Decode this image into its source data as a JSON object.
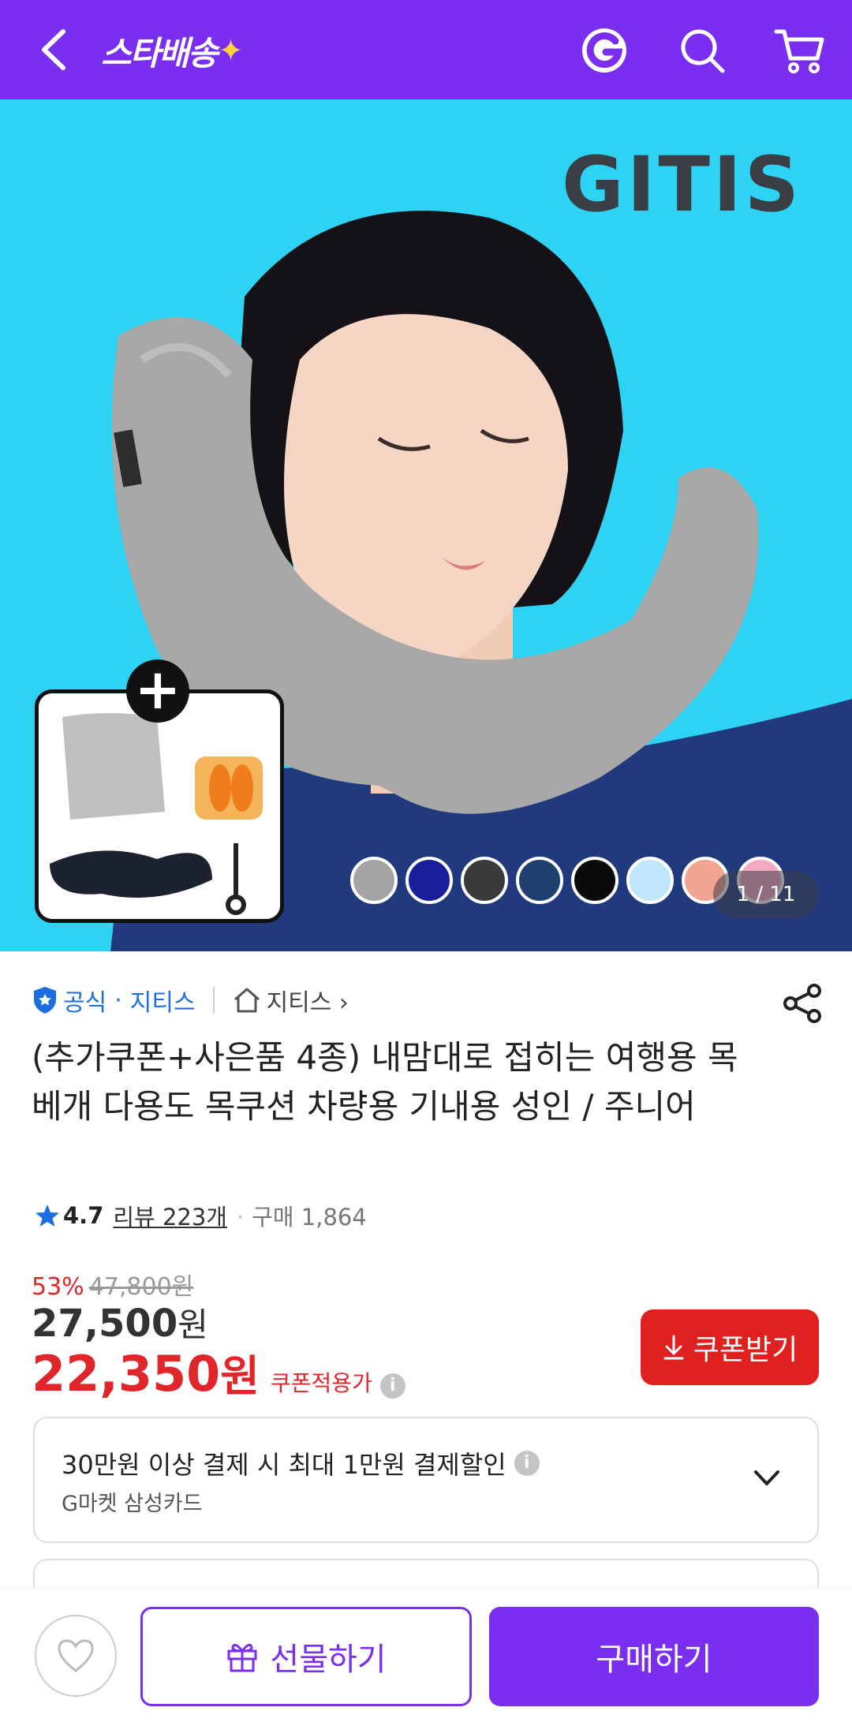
{
  "header": {
    "logo_text": "스타배송",
    "logo_sparkle": "✦",
    "icons": [
      "back-icon",
      "g-icon",
      "search-icon",
      "cart-icon"
    ]
  },
  "hero": {
    "brand": "GITIS",
    "page_indicator": "1 / 11",
    "swatch_colors": [
      "#a4a4a4",
      "#1b1e9a",
      "#3a3a3a",
      "#1f3f6e",
      "#0a0a0a",
      "#bfe6fb",
      "#f2a593",
      "#f3a9c2"
    ]
  },
  "store": {
    "official_label": "공식",
    "seller_name": "지티스",
    "store_link": "지티스 ›"
  },
  "product": {
    "title": "(추가쿠폰+사은품 4종) 내맘대로 접히는 여행용 목베개 다용도 목쿠션 차량용 기내용 성인 / 주니어",
    "rating": "4.7",
    "review_text": "리뷰 223개",
    "buy_count": "구매 1,864"
  },
  "pricing": {
    "discount_rate": "53%",
    "original_price": "47,800원",
    "price_number": "27,500",
    "price_unit": "원",
    "coupon_price_number": "22,350",
    "coupon_price_unit": "원",
    "coupon_note": "쿠폰적용가",
    "coupon_button": "쿠폰받기"
  },
  "promo": {
    "main": "30만원 이상 결제 시 최대 1만원 결제할인",
    "sub": "G마켓 삼성카드"
  },
  "bottom_bar": {
    "gift_label": "선물하기",
    "buy_label": "구매하기"
  },
  "colors": {
    "brand_purple": "#7a2ff0",
    "sale_red": "#e0262a",
    "hero_bg": "#2ed3f3"
  }
}
